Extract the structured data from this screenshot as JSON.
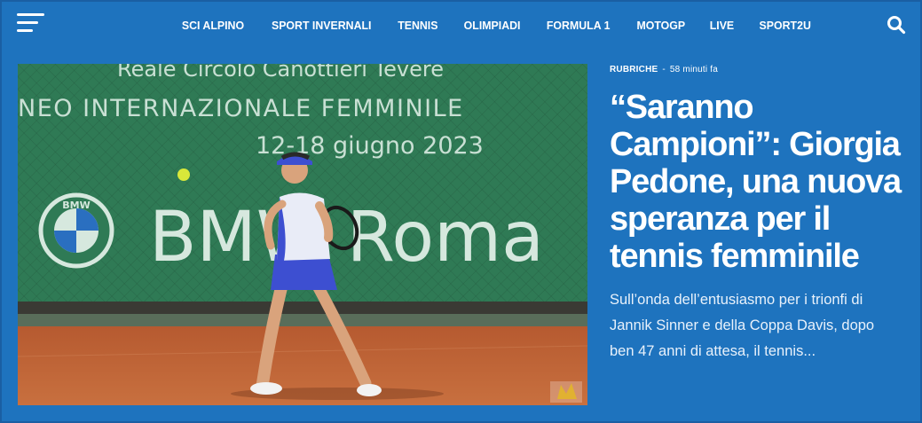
{
  "header": {
    "menu_icon": "hamburger-menu-icon",
    "nav": [
      "SCI ALPINO",
      "SPORT INVERNALI",
      "TENNIS",
      "OLIMPIADI",
      "FORMULA 1",
      "MOTOGP",
      "LIVE",
      "SPORT2U"
    ],
    "search_icon": "search-icon"
  },
  "feature": {
    "image": {
      "banner_line1": "Reale Circolo Canottieri Tevere",
      "banner_line2": "NEO INTERNAZIONALE FEMMINILE",
      "banner_line3": "12-18 giugno 2023",
      "sponsor": "BMW Roma",
      "logo_text": "BMW"
    },
    "category": "RUBRICHE",
    "separator": "-",
    "time": "58 minuti fa",
    "headline": "“Saranno Campioni”: Giorgia Pedone, una nuova speranza per il tennis femminile",
    "excerpt": "Sull’onda dell’entusiasmo per i trionfi di Jannik Sinner e della Coppa Davis, dopo ben 47 anni di attesa, il tennis..."
  },
  "colors": {
    "background": "#1e73be",
    "text": "#ffffff",
    "banner_green": "#2f7a55",
    "clay": "#c86a3c"
  }
}
